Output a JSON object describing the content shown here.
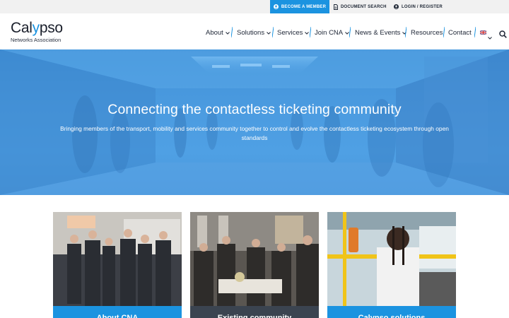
{
  "topbar": {
    "become_member": "BECOME A MEMBER",
    "document_search": "DOCUMENT SEARCH",
    "login_register": "LOGIN / REGISTER"
  },
  "logo": {
    "name_pre": "Cal",
    "name_y": "y",
    "name_post": "pso",
    "subtitle": "Networks Association"
  },
  "nav": {
    "items": [
      {
        "label": "About"
      },
      {
        "label": "Solutions"
      },
      {
        "label": "Services"
      },
      {
        "label": "Join CNA"
      },
      {
        "label": "News & Events"
      },
      {
        "label": "Resources"
      },
      {
        "label": "Contact"
      }
    ]
  },
  "hero": {
    "title": "Connecting the contactless ticketing community",
    "subtitle": "Bringing members of the transport, mobility and services community together to control and evolve the contactless ticketing ecosystem through open standards"
  },
  "cards": [
    {
      "title": "About CNA"
    },
    {
      "title": "Existing community"
    },
    {
      "title": "Calypso solutions"
    }
  ],
  "colors": {
    "accent": "#1b93e0",
    "topbar_bg": "#f1f1f1",
    "dark_band": "#3b4450"
  }
}
